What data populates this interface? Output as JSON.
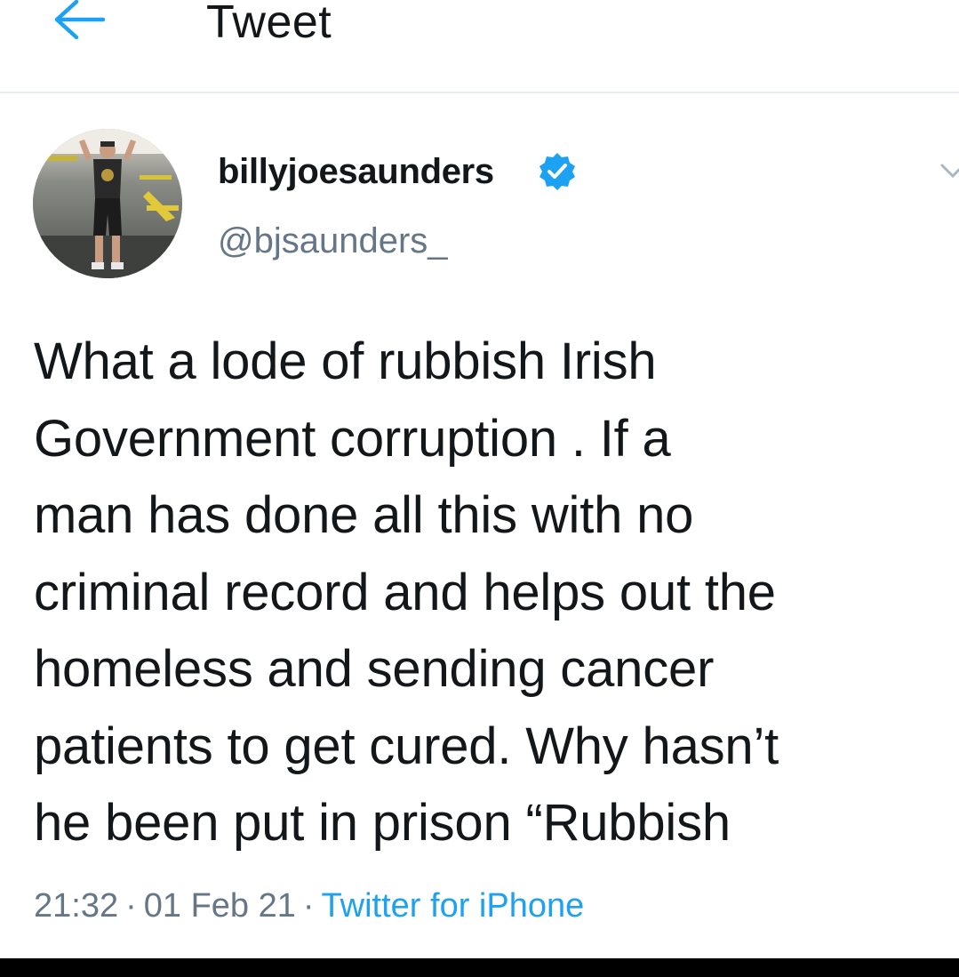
{
  "header": {
    "title": "Tweet",
    "back_icon": "arrow-left-icon",
    "accent_color": "#1da1f2"
  },
  "author": {
    "display_name": "billyjoesaunders",
    "handle": "@bjsaunders_",
    "verified": true,
    "verified_icon": "verified-badge-icon",
    "avatar": "profile-photo"
  },
  "tweet": {
    "text": "What a lode of rubbish Irish\nGovernment corruption . If a\nman has done all this with no\ncriminal record and helps out the\nhomeless and sending cancer\npatients to get cured. Why hasn’t\nhe been put in prison  “Rubbish",
    "time": "21:32",
    "date": "01 Feb 21",
    "separator": "·",
    "source": "Twitter for iPhone"
  },
  "colors": {
    "text_primary": "#14171a",
    "text_secondary": "#657786",
    "divider": "#e6ecf0",
    "link": "#1da1f2"
  }
}
